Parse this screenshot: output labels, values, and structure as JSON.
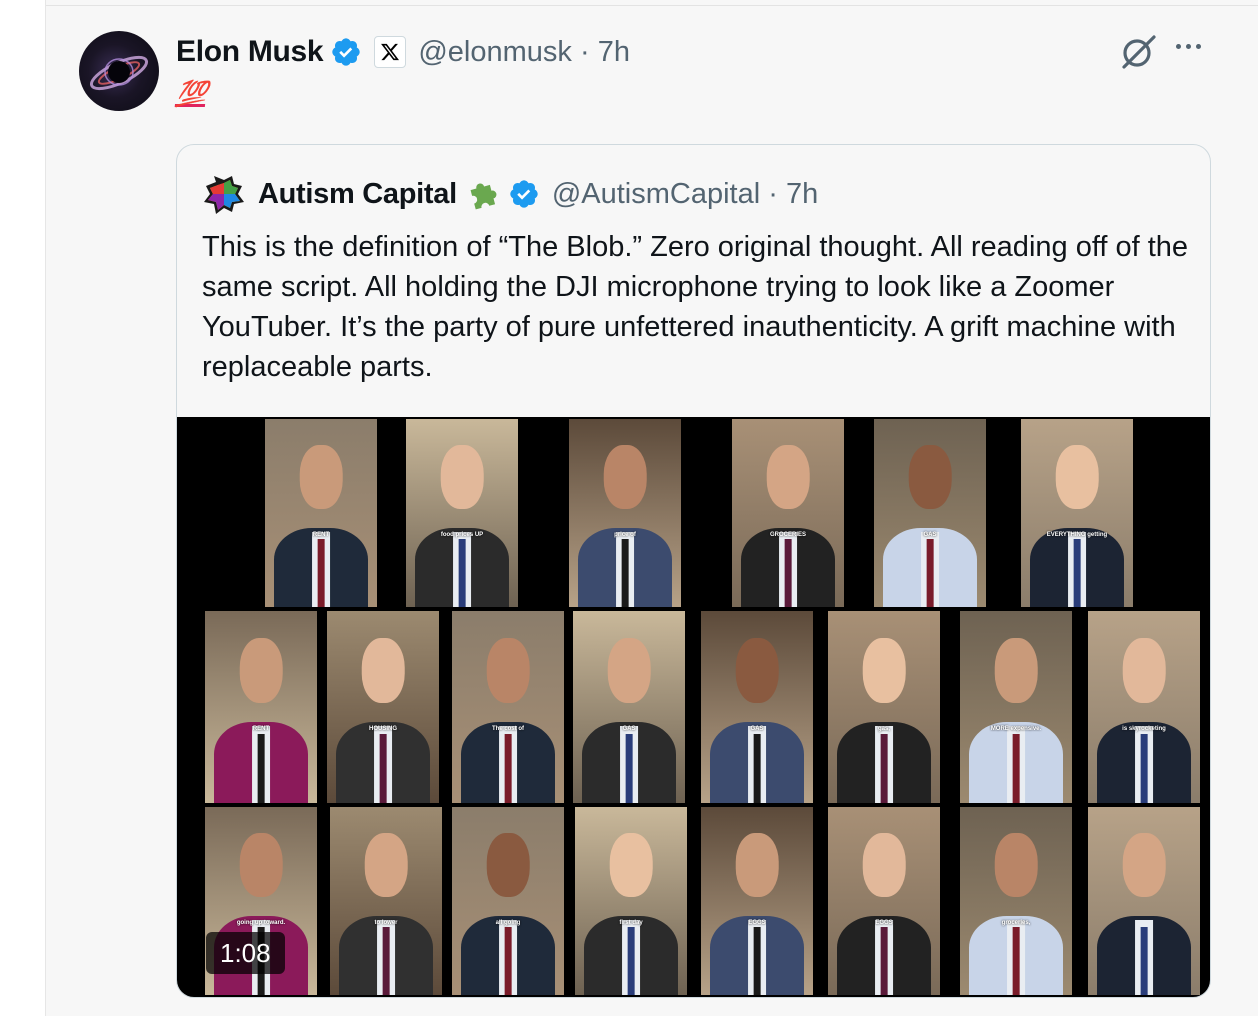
{
  "tweet": {
    "author_name": "Elon Musk",
    "handle": "@elonmusk",
    "separator": "·",
    "time": "7h",
    "text": "💯",
    "colors": {
      "verified": "#1d9bf0",
      "handle": "#536471"
    }
  },
  "quote": {
    "author_name": "Autism Capital",
    "handle": "@AutismCapital",
    "separator": "·",
    "time": "7h",
    "text": "This is the definition of “The Blob.” Zero original thought. All reading off of the same script. All holding the DJI microphone trying to look like a Zoomer YouTuber. It’s the party of pure unfettered inauthenticity. A grift machine with replaceable parts.",
    "media": {
      "duration": "1:08",
      "captions": [
        "RENT",
        "food prices UP",
        "price of",
        "GROCERIES",
        "GAS",
        "EVERYTHING getting",
        "RENT",
        "HOUSING",
        "The cost of",
        "GAS",
        "GAS",
        "gas,",
        "MORE expensive.",
        "is skyrocketing",
        "going up toward.",
        "to lower",
        "all going",
        "first day",
        "EGGS",
        "EGGS",
        "groceries,"
      ]
    }
  },
  "icons": [
    "grok-icon",
    "more-icon",
    "verified-badge-icon",
    "x-logo-icon",
    "puzzle-icon",
    "rainbow-puzzle-avatar"
  ]
}
